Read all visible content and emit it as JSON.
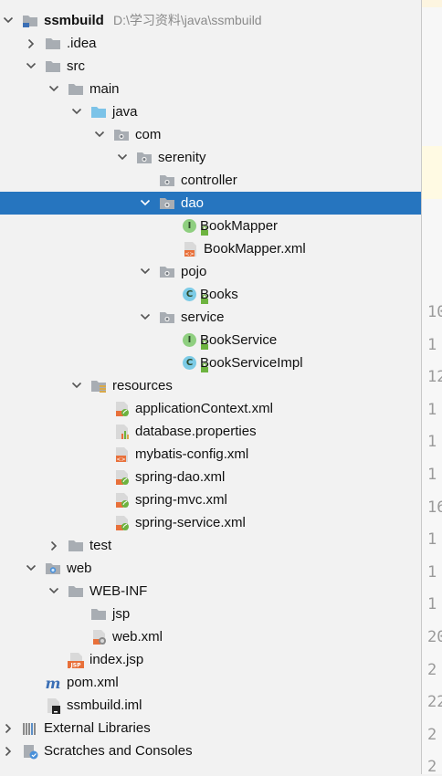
{
  "project": {
    "name": "ssmbuild",
    "path": "D:\\学习资料\\java\\ssmbuild"
  },
  "tree": [
    {
      "label": "ssmbuild",
      "hint": "D:\\学习资料\\java\\ssmbuild",
      "icon": "module-folder-icon",
      "expanded": true,
      "depth": 0
    },
    {
      "label": ".idea",
      "icon": "folder-icon",
      "expanded": false,
      "depth": 1
    },
    {
      "label": "src",
      "icon": "folder-icon",
      "expanded": true,
      "depth": 1
    },
    {
      "label": "main",
      "icon": "folder-icon",
      "expanded": true,
      "depth": 2
    },
    {
      "label": "java",
      "icon": "source-folder-icon",
      "expanded": true,
      "depth": 3
    },
    {
      "label": "com",
      "icon": "package-icon",
      "expanded": true,
      "depth": 4
    },
    {
      "label": "serenity",
      "icon": "package-icon",
      "expanded": true,
      "depth": 5
    },
    {
      "label": "controller",
      "icon": "package-icon",
      "depth": 6
    },
    {
      "label": "dao",
      "icon": "package-icon",
      "expanded": true,
      "depth": 6,
      "selected": true
    },
    {
      "label": "BookMapper",
      "icon": "interface-icon",
      "depth": 7
    },
    {
      "label": "BookMapper.xml",
      "icon": "xml-file-icon",
      "depth": 7
    },
    {
      "label": "pojo",
      "icon": "package-icon",
      "expanded": true,
      "depth": 6
    },
    {
      "label": "Books",
      "icon": "class-icon",
      "depth": 7
    },
    {
      "label": "service",
      "icon": "package-icon",
      "expanded": true,
      "depth": 6
    },
    {
      "label": "BookService",
      "icon": "interface-icon",
      "depth": 7
    },
    {
      "label": "BookServiceImpl",
      "icon": "class-icon",
      "depth": 7
    },
    {
      "label": "resources",
      "icon": "resources-folder-icon",
      "expanded": true,
      "depth": 3
    },
    {
      "label": "applicationContext.xml",
      "icon": "spring-xml-icon",
      "depth": 4
    },
    {
      "label": "database.properties",
      "icon": "properties-file-icon",
      "depth": 4
    },
    {
      "label": "mybatis-config.xml",
      "icon": "xml-file-icon",
      "depth": 4
    },
    {
      "label": "spring-dao.xml",
      "icon": "spring-xml-icon",
      "depth": 4
    },
    {
      "label": "spring-mvc.xml",
      "icon": "spring-xml-icon",
      "depth": 4
    },
    {
      "label": "spring-service.xml",
      "icon": "spring-xml-icon",
      "depth": 4
    },
    {
      "label": "test",
      "icon": "folder-icon",
      "expanded": false,
      "depth": 2
    },
    {
      "label": "web",
      "icon": "web-folder-icon",
      "expanded": true,
      "depth": 1
    },
    {
      "label": "WEB-INF",
      "icon": "folder-icon",
      "expanded": true,
      "depth": 2
    },
    {
      "label": "jsp",
      "icon": "folder-icon",
      "depth": 3
    },
    {
      "label": "web.xml",
      "icon": "web-xml-icon",
      "depth": 3
    },
    {
      "label": "index.jsp",
      "icon": "jsp-file-icon",
      "depth": 2
    },
    {
      "label": "pom.xml",
      "icon": "maven-icon",
      "depth": 1
    },
    {
      "label": "ssmbuild.iml",
      "icon": "iml-file-icon",
      "depth": 1
    },
    {
      "label": "External Libraries",
      "icon": "libraries-icon",
      "expanded": false,
      "depth": 0
    },
    {
      "label": "Scratches and Consoles",
      "icon": "scratches-icon",
      "expanded": false,
      "depth": 0
    }
  ],
  "gutter": [
    "10",
    "1",
    "12",
    "1",
    "1",
    "1",
    "16",
    "1",
    "1",
    "1",
    "20",
    "2",
    "22",
    "2",
    "2"
  ],
  "colors": {
    "selection": "#2675bf",
    "folder": "#a8adb3",
    "source_folder": "#7cc3e8",
    "interface_badge": "#8fcf80",
    "class_badge": "#7ccbe6",
    "xml_orange": "#e8703a",
    "spring_green": "#6db33f"
  }
}
